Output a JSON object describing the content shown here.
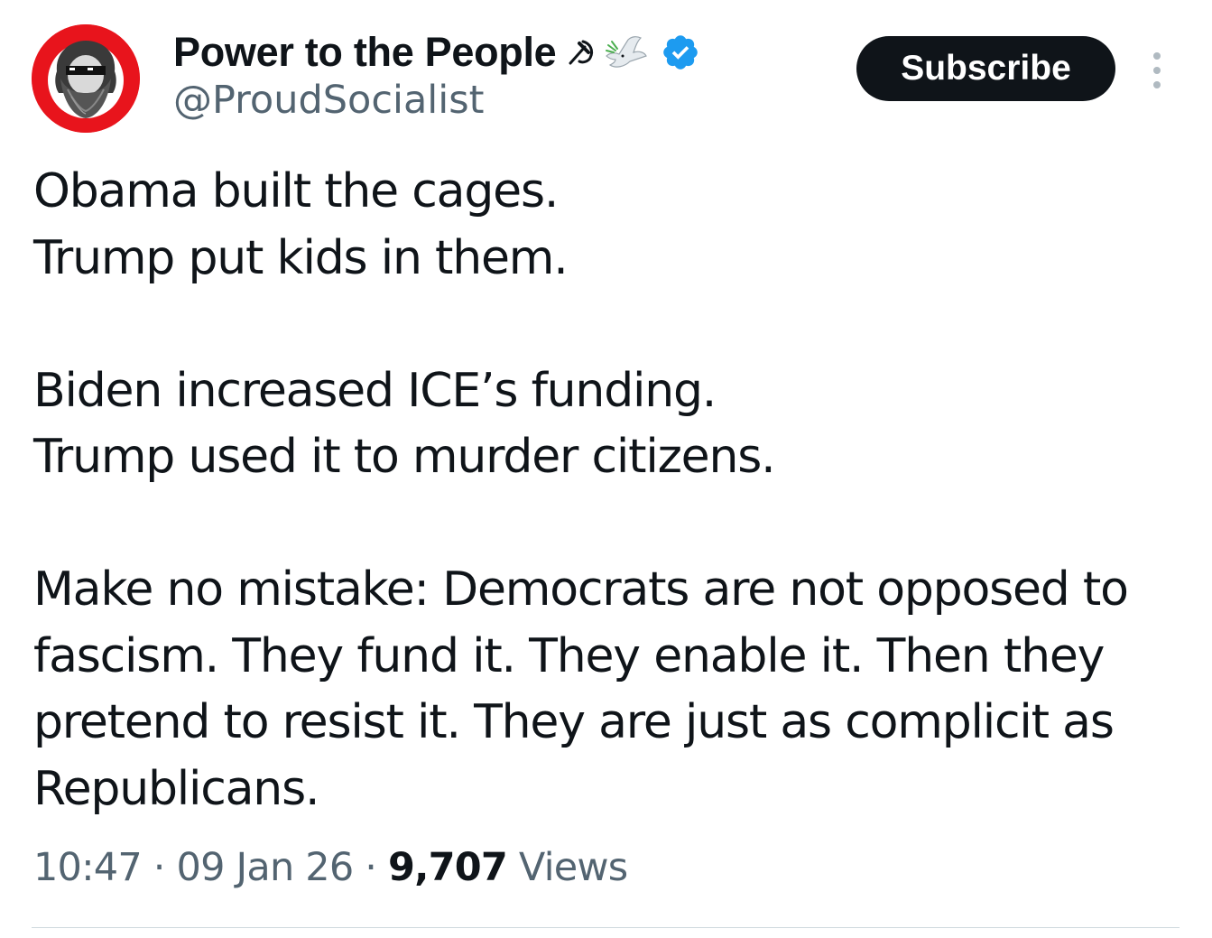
{
  "author": {
    "display_name": "Power to the People",
    "name_emojis": [
      "hammer-and-sickle",
      "dove"
    ],
    "verified": true,
    "handle": "@ProudSocialist"
  },
  "actions": {
    "subscribe_label": "Subscribe",
    "more_icon": "ellipsis-vertical-icon"
  },
  "tweet": {
    "paragraphs": [
      [
        "Obama built the cages.",
        "Trump put kids in them."
      ],
      [
        "Biden increased ICE’s funding.",
        "Trump used it to murder citizens."
      ],
      [
        "Make no mistake: Democrats are not opposed to",
        "fascism. They fund it. They enable it. Then they",
        "pretend to resist it. They are just as complicit as",
        "Republicans."
      ]
    ]
  },
  "meta": {
    "time": "10:47",
    "separator": "·",
    "date": "09 Jan 26",
    "views_count": "9,707",
    "views_label": "Views"
  },
  "colors": {
    "text_primary": "#0f1419",
    "text_secondary": "#536471",
    "verified_blue": "#1d9bf0",
    "avatar_red": "#e8141c",
    "divider": "#cfd9de"
  }
}
